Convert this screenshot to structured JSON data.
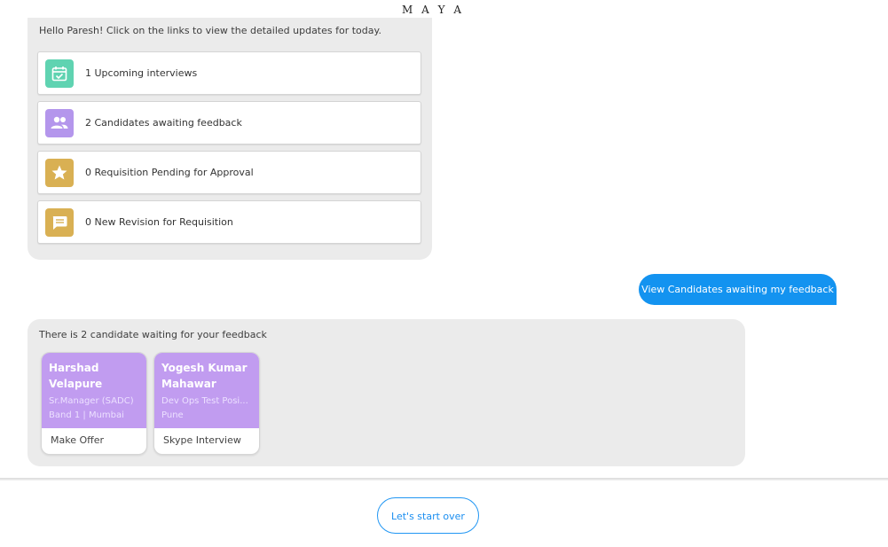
{
  "app": {
    "title": "M A Y A"
  },
  "greeting": {
    "text": "Hello Paresh! Click on the links to view the detailed updates for today.",
    "links": [
      {
        "label": "1 Upcoming interviews",
        "icon": "calendar-check-icon",
        "color": "#5fd3b1"
      },
      {
        "label": "2 Candidates awaiting feedback",
        "icon": "people-icon",
        "color": "#b496ec"
      },
      {
        "label": "0 Requisition Pending for Approval",
        "icon": "star-icon",
        "color": "#d9b053"
      },
      {
        "label": "0 New Revision for Requisition",
        "icon": "message-icon",
        "color": "#d9b053"
      }
    ]
  },
  "user_message": {
    "text": "View Candidates awaiting my feedback",
    "color": "#1393f0"
  },
  "feedback": {
    "text": "There is 2 candidate waiting for your feedback",
    "candidates": [
      {
        "name": "Harshad Velapure",
        "role": "Sr.Manager (SADC)",
        "location": "Band 1 | Mumbai",
        "action": "Make Offer"
      },
      {
        "name": "Yogesh Kumar Mahawar",
        "role": "Dev Ops Test Posi...",
        "location": "Pune",
        "action": "Skype Interview"
      }
    ],
    "card_color": "#c19cf0"
  },
  "footer": {
    "start_over_label": "Let's start over",
    "accent": "#2196f3"
  }
}
